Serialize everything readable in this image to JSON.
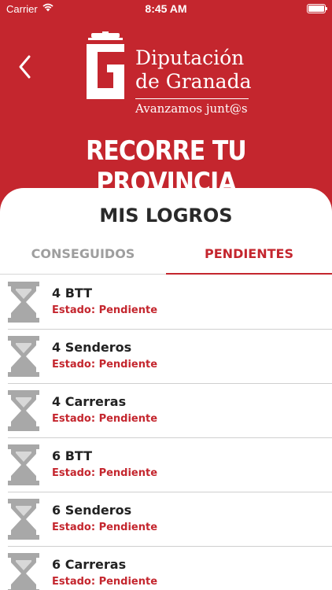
{
  "status_bar": {
    "carrier": "Carrier",
    "time": "8:45 AM"
  },
  "header": {
    "logo_line1": "Diputación",
    "logo_line2": "de Granada",
    "tagline": "Avanzamos junt@s",
    "page_title": "RECORRE TU PROVINCIA"
  },
  "card": {
    "title": "MIS LOGROS",
    "tabs": [
      {
        "label": "CONSEGUIDOS",
        "active": false
      },
      {
        "label": "PENDIENTES",
        "active": true
      }
    ],
    "items": [
      {
        "title": "4 BTT",
        "status": "Estado: Pendiente",
        "icon": "hourglass-icon"
      },
      {
        "title": "4 Senderos",
        "status": "Estado: Pendiente",
        "icon": "hourglass-icon"
      },
      {
        "title": "4 Carreras",
        "status": "Estado: Pendiente",
        "icon": "hourglass-icon"
      },
      {
        "title": "6 BTT",
        "status": "Estado: Pendiente",
        "icon": "hourglass-icon"
      },
      {
        "title": "6 Senderos",
        "status": "Estado: Pendiente",
        "icon": "hourglass-icon"
      },
      {
        "title": "6 Carreras",
        "status": "Estado: Pendiente",
        "icon": "hourglass-icon"
      }
    ]
  },
  "colors": {
    "brand_red": "#c4262e",
    "inactive_gray": "#9e9e9e",
    "icon_gray": "#a8a8a8"
  }
}
